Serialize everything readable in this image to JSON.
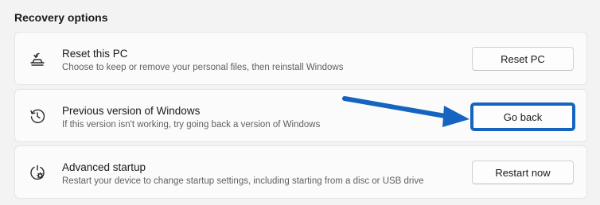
{
  "section": {
    "title": "Recovery options"
  },
  "options": [
    {
      "title": "Reset this PC",
      "description": "Choose to keep or remove your personal files, then reinstall Windows",
      "button_label": "Reset PC",
      "icon": "reset-pc-icon"
    },
    {
      "title": "Previous version of Windows",
      "description": "If this version isn't working, try going back a version of Windows",
      "button_label": "Go back",
      "icon": "history-clock-icon"
    },
    {
      "title": "Advanced startup",
      "description": "Restart your device to change startup settings, including starting from a disc or USB drive",
      "button_label": "Restart now",
      "icon": "advanced-startup-icon"
    }
  ],
  "annotation": {
    "arrow_color": "#1565c0",
    "highlight_color": "#1565c0"
  }
}
